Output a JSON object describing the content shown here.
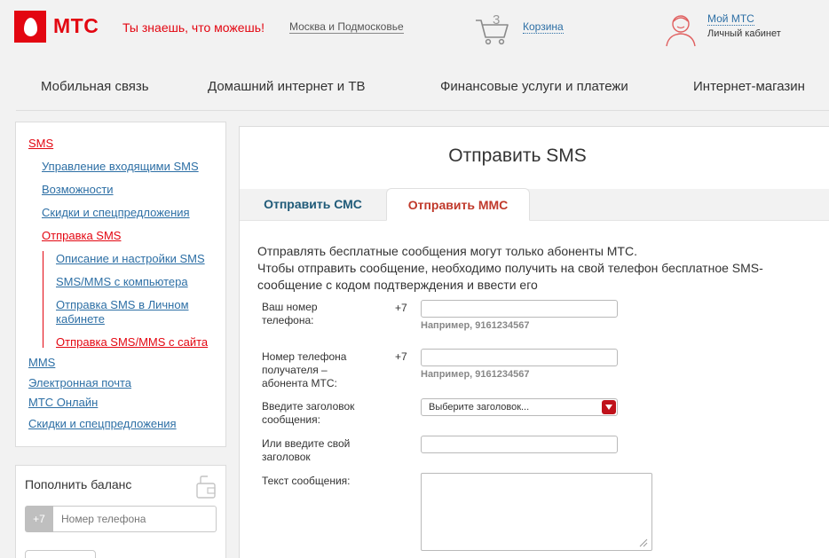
{
  "header": {
    "logo_text": "МТС",
    "slogan": "Ты знаешь, что можешь!",
    "region": "Москва и Подмосковье",
    "cart_count": "3",
    "cart_label": "Корзина",
    "account_label": "Мой МТС",
    "account_sublabel": "Личный кабинет"
  },
  "topnav": [
    "Мобильная связь",
    "Домашний интернет и ТВ",
    "Финансовые услуги и платежи",
    "Интернет-магазин"
  ],
  "sidebar": {
    "items": [
      {
        "label": "SMS",
        "active": true
      },
      {
        "label": "Управление входящими SMS"
      },
      {
        "label": "Возможности"
      },
      {
        "label": "Скидки и спецпредложения"
      },
      {
        "label": "Отправка SMS",
        "active": true
      },
      {
        "label": "Описание и настройки SMS"
      },
      {
        "label": "SMS/MMS с компьютера"
      },
      {
        "label": "Отправка SMS в Личном кабинете"
      },
      {
        "label": "Отправка SMS/MMS с сайта",
        "active": true
      },
      {
        "label": "MMS"
      },
      {
        "label": "Электронная почта"
      },
      {
        "label": "МТС Онлайн"
      },
      {
        "label": "Скидки и спецпредложения"
      }
    ]
  },
  "balance": {
    "title": "Пополнить баланс",
    "prefix": "+7",
    "placeholder": "Номер телефона"
  },
  "main": {
    "title": "Отправить SMS",
    "tabs": [
      {
        "label": "Отправить СМС"
      },
      {
        "label": "Отправить ММС",
        "active": true
      }
    ],
    "intro_line1": "Отправлять бесплатные сообщения могут только абоненты МТС.",
    "intro_line2": "Чтобы отправить сообщение, необходимо получить на свой телефон бесплатное SMS-сообщение с кодом подтверждения и ввести его",
    "form": {
      "your_phone_label": "Ваш номер телефона:",
      "your_phone_prefix": "+7",
      "your_phone_hint": "Например, 9161234567",
      "recipient_label": "Номер телефона получателя – абонента МТС:",
      "recipient_prefix": "+7",
      "recipient_hint": "Например, 9161234567",
      "subject_select_label": "Введите заголовок сообщения:",
      "subject_select_value": "Выберите заголовок...",
      "custom_subject_label": "Или введите свой заголовок",
      "message_label": "Текст сообщения:"
    }
  },
  "colors": {
    "brand_red": "#e30611",
    "link_blue": "#2d6fa5",
    "tab_blue": "#1f5a78"
  }
}
